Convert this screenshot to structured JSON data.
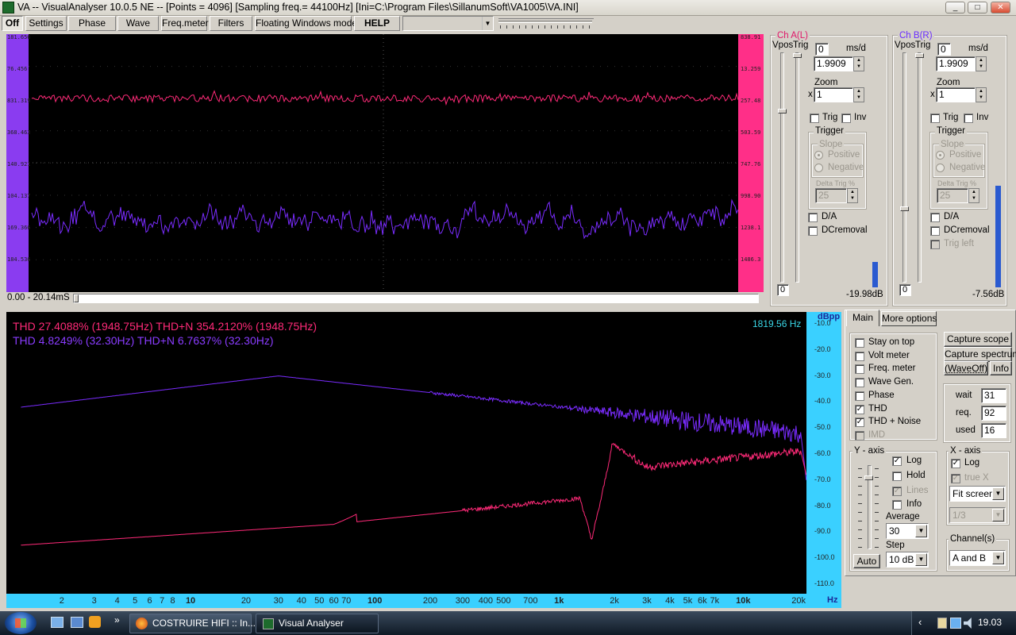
{
  "window": {
    "title": "VA -- VisualAnalyser 10.0.5 NE --  [Points = 4096]  [Sampling freq.= 44100Hz]  [Ini=C:\\Program Files\\SillanumSoft\\VA1005\\VA.INI]"
  },
  "toolbar": {
    "off_label": "Off",
    "items": [
      "Settings",
      "Phase",
      "Wave",
      "Freq.meter",
      "Filters",
      "Floating Windows mode",
      "HELP"
    ]
  },
  "scope": {
    "time_range": "0.00 - 20.14mS",
    "left_scale": [
      "181.656",
      "76.456",
      "831.319",
      "368.463",
      "140.921",
      "104.137",
      "169.366",
      "184.536"
    ],
    "right_scale": [
      "838.91",
      "13.259",
      "257.48",
      "503.59",
      "747.76",
      "998.90",
      "1238.1",
      "1486.3"
    ]
  },
  "chA": {
    "title": "Ch A(L)",
    "vpos_label": "Vpos",
    "trig_label": "Trig",
    "ms_d_label": "ms/d",
    "ms_value": "0",
    "ms_d_value": "1.9909",
    "zoom_label": "Zoom",
    "zoom_prefix": "x",
    "zoom_value": "1",
    "trig_check": "Trig",
    "inv_check": "Inv",
    "trigger_group": "Trigger",
    "slope_group": "Slope",
    "positive": "Positive",
    "negative": "Negative",
    "delta_label": "Delta Trig %",
    "delta_value": "25",
    "da": "D/A",
    "dcremoval": "DCremoval",
    "vpos_value": "0",
    "level_db": "-19.98dB"
  },
  "chB": {
    "title": "Ch B(R)",
    "vpos_label": "Vpos",
    "trig_label": "Trig",
    "ms_d_label": "ms/d",
    "ms_value": "0",
    "ms_d_value": "1.9909",
    "zoom_label": "Zoom",
    "zoom_prefix": "x",
    "zoom_value": "1",
    "trig_check": "Trig",
    "inv_check": "Inv",
    "trigger_group": "Trigger",
    "slope_group": "Slope",
    "positive": "Positive",
    "negative": "Negative",
    "delta_label": "Delta Trig %",
    "delta_value": "25",
    "da": "D/A",
    "dcremoval": "DCremoval",
    "trig_left": "Trig left",
    "vpos_value": "0",
    "level_db": "-7.56dB"
  },
  "spectrum": {
    "thd_a": "THD 27.4088% (1948.75Hz)  THD+N 354.2120% (1948.75Hz)",
    "thd_b": "THD 4.8249% (32.30Hz)  THD+N 6.7637% (32.30Hz)",
    "cursor_freq": "1819.56 Hz",
    "y_unit": "dBpp",
    "y_ticks": [
      "-10.0",
      "-20.0",
      "-30.0",
      "-40.0",
      "-50.0",
      "-60.0",
      "-70.0",
      "-80.0",
      "-90.0",
      "-100.0",
      "-110.0"
    ],
    "x_unit": "Hz",
    "x_ticks": [
      "2",
      "3",
      "4",
      "5",
      "6",
      "7",
      "8",
      "10",
      "20",
      "30",
      "40",
      "50",
      "60",
      "70",
      "100",
      "200",
      "300",
      "400",
      "500",
      "700",
      "1k",
      "2k",
      "3k",
      "4k",
      "5k",
      "6k",
      "7k",
      "10k",
      "20k"
    ]
  },
  "options": {
    "tabs": [
      "Main",
      "More options"
    ],
    "checks": [
      {
        "label": "Stay on top",
        "checked": false
      },
      {
        "label": "Volt meter",
        "checked": false
      },
      {
        "label": "Freq. meter",
        "checked": false
      },
      {
        "label": "Wave Gen.",
        "checked": false
      },
      {
        "label": "Phase",
        "checked": false
      },
      {
        "label": "THD",
        "checked": true
      },
      {
        "label": "THD + Noise",
        "checked": true
      },
      {
        "label": "IMD",
        "checked": false
      }
    ],
    "buttons": {
      "capture_scope": "Capture scope",
      "capture_spectrum": "Capture spectrum",
      "waveoff": "(WaveOff)",
      "info": "Info"
    },
    "stats": [
      {
        "label": "wait",
        "value": "31"
      },
      {
        "label": "req.",
        "value": "92"
      },
      {
        "label": "used",
        "value": "16"
      }
    ],
    "yaxis": {
      "title": "Y - axis",
      "log": "Log",
      "hold": "Hold",
      "lines": "Lines",
      "info": "Info",
      "average_label": "Average",
      "average_value": "30",
      "step_label": "Step",
      "step_value": "10 dB",
      "auto": "Auto"
    },
    "xaxis": {
      "title": "X - axis",
      "log": "Log",
      "truex": "true X",
      "mode": "Fit screen",
      "fraction": "1/3"
    },
    "channels": {
      "title": "Channel(s)",
      "value": "A and B"
    }
  },
  "taskbar": {
    "tasks": [
      "COSTRUIRE HIFI :: In...",
      "Visual Analyser"
    ],
    "clock": "19.03"
  },
  "colors": {
    "chA": "#ff2a78",
    "chB": "#7a2cff",
    "cursor": "#3ad8e8"
  }
}
